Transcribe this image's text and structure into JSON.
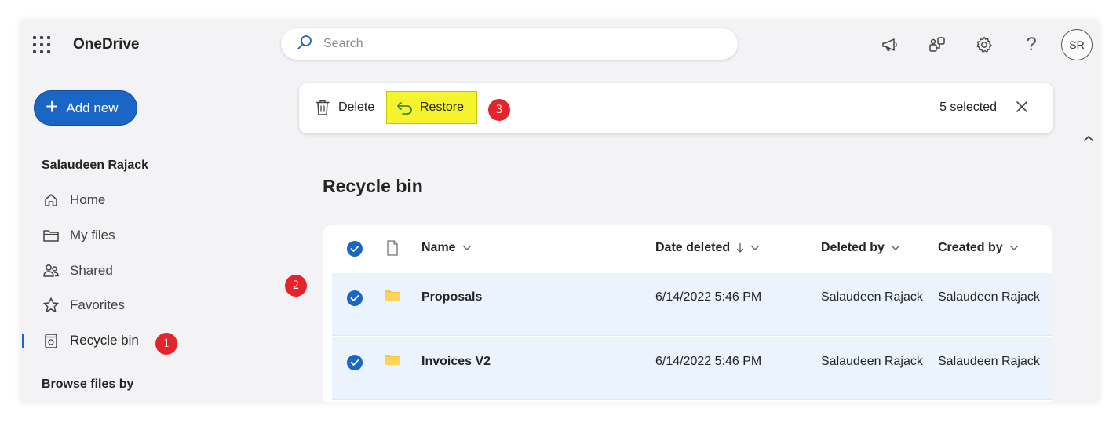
{
  "app": {
    "title": "OneDrive"
  },
  "search": {
    "placeholder": "Search"
  },
  "header": {
    "avatar_initials": "SR"
  },
  "sidebar": {
    "add_new_label": "Add new",
    "user_name": "Salaudeen Rajack",
    "items": [
      {
        "label": "Home",
        "icon": "home-icon"
      },
      {
        "label": "My files",
        "icon": "folder-icon"
      },
      {
        "label": "Shared",
        "icon": "people-icon"
      },
      {
        "label": "Favorites",
        "icon": "star-icon"
      },
      {
        "label": "Recycle bin",
        "icon": "recycle-bin-icon",
        "active": true
      }
    ],
    "browse_label": "Browse files by"
  },
  "commandbar": {
    "delete_label": "Delete",
    "restore_label": "Restore",
    "selected_text": "5 selected",
    "restore_highlight_color": "#f5f32e"
  },
  "main": {
    "title": "Recycle bin"
  },
  "list": {
    "columns": [
      "Name",
      "Date deleted",
      "Deleted by",
      "Created by"
    ],
    "rows": [
      {
        "name": "Proposals",
        "date_deleted": "6/14/2022 5:46 PM",
        "deleted_by": "Salaudeen Rajack",
        "created_by": "Salaudeen Rajack"
      },
      {
        "name": "Invoices V2",
        "date_deleted": "6/14/2022 5:46 PM",
        "deleted_by": "Salaudeen Rajack",
        "created_by": "Salaudeen Rajack"
      }
    ]
  },
  "annotations": {
    "badge_1": "1",
    "badge_2": "2",
    "badge_3": "3",
    "badge_color": "#e3242b"
  },
  "colors": {
    "accent": "#1a66c7",
    "selected_row": "#ebf3fc",
    "folder": "#f4c542"
  }
}
